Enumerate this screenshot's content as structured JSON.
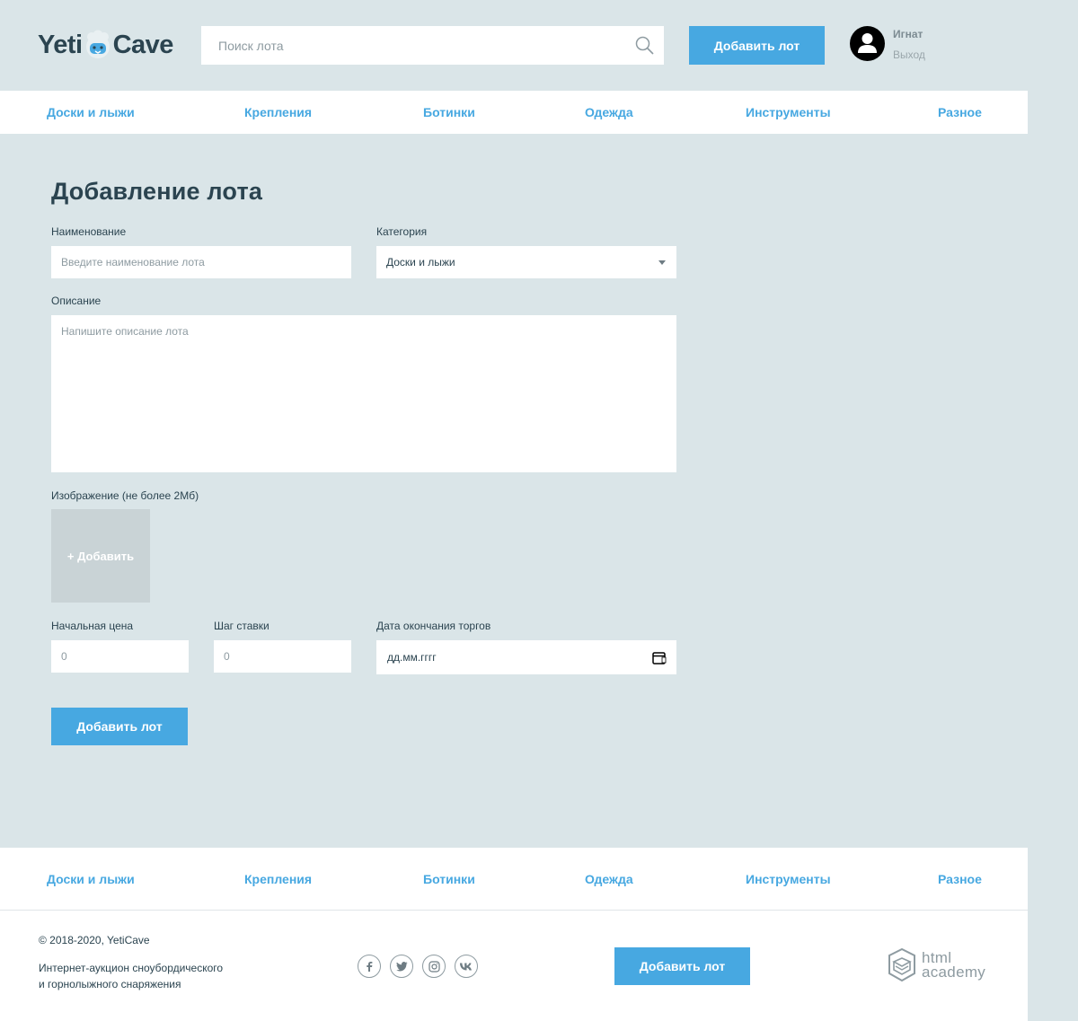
{
  "header": {
    "logo_left": "Yeti",
    "logo_right": "Cave",
    "search_placeholder": "Поиск лота",
    "add_lot_label": "Добавить лот",
    "user_name": "Игнат",
    "logout_label": "Выход"
  },
  "nav": {
    "items": [
      "Доски и лыжи",
      "Крепления",
      "Ботинки",
      "Одежда",
      "Инструменты",
      "Разное"
    ]
  },
  "form": {
    "title": "Добавление лота",
    "name_label": "Наименование",
    "name_placeholder": "Введите наименование лота",
    "category_label": "Категория",
    "category_value": "Доски и лыжи",
    "description_label": "Описание",
    "description_placeholder": "Напишите описание лота",
    "image_label": "Изображение (не более 2Мб)",
    "image_add_label": "+ Добавить",
    "start_price_label": "Начальная цена",
    "start_price_placeholder": "0",
    "step_label": "Шаг ставки",
    "step_placeholder": "0",
    "end_date_label": "Дата окончания торгов",
    "end_date_value": "дд.мм.гггг",
    "submit_label": "Добавить лот"
  },
  "footer": {
    "nav_items": [
      "Доски и лыжи",
      "Крепления",
      "Ботинки",
      "Одежда",
      "Инструменты",
      "Разное"
    ],
    "copyright": "© 2018-2020, YetiCave",
    "about_line1": "Интернет-аукцион сноубордического",
    "about_line2": "и горнолыжного снаряжения",
    "social_icons": [
      "facebook-icon",
      "twitter-icon",
      "instagram-icon",
      "vk-icon"
    ],
    "add_lot_label": "Добавить лот",
    "academy_line1": "html",
    "academy_line2": "academy"
  },
  "colors": {
    "background": "#dae5e8",
    "accent": "#47a8e1",
    "text": "#2b4450",
    "image_drop": "#c9d3d6"
  }
}
